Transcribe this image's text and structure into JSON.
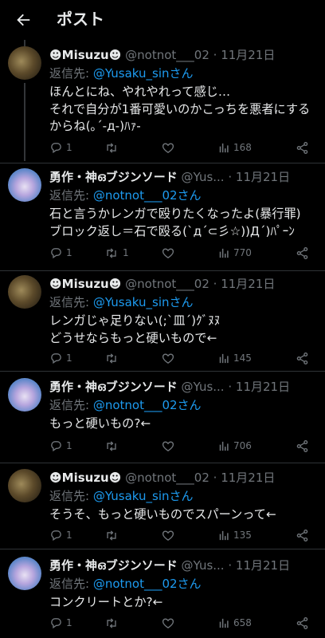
{
  "header": {
    "title": "ポスト"
  },
  "users": {
    "misuzu": {
      "name": "☻Misuzu☻",
      "handle": "@notnot___02"
    },
    "yusaku": {
      "name": "勇作・神ഒブジンソード",
      "handle": "@Yus..."
    }
  },
  "reply_prefix": "返信先:",
  "dot": "·",
  "tweets": [
    {
      "name": "☻Misuzu☻",
      "handle": "@notnot___02",
      "date": "11月21日",
      "reply_to": "@Yusaku_sinさん",
      "text": "ほんとにね、やれやれって感じ…\nそれで自分が1番可愛いのかこっちを悪者にするからね(｡´-д-)ﾊｧ-",
      "replies": "1",
      "retweets": "",
      "likes": "",
      "views": "168"
    },
    {
      "name": "勇作・神ഒブジンソード",
      "handle": "@Yus...",
      "date": "11月21日",
      "reply_to": "@notnot___02さん",
      "text": "石と言うかレンガで殴りたくなったよ(暴行罪)\nブロック返し＝石で殴る(`д´⊂彡☆))Д´)ﾊﾟｰﾝ",
      "replies": "1",
      "retweets": "1",
      "likes": "",
      "views": "770"
    },
    {
      "name": "☻Misuzu☻",
      "handle": "@notnot___02",
      "date": "11月21日",
      "reply_to": "@Yusaku_sinさん",
      "text": "レンガじゃ足りない(;`皿´)ｸﾞﾇﾇ\nどうせならもっと硬いもので←",
      "replies": "1",
      "retweets": "",
      "likes": "",
      "views": "145"
    },
    {
      "name": "勇作・神ഒブジンソード",
      "handle": "@Yus...",
      "date": "11月21日",
      "reply_to": "@notnot___02さん",
      "text": "もっと硬いもの?←",
      "replies": "1",
      "retweets": "",
      "likes": "",
      "views": "706"
    },
    {
      "name": "☻Misuzu☻",
      "handle": "@notnot___02",
      "date": "11月21日",
      "reply_to": "@Yusaku_sinさん",
      "text": "そうそ、もっと硬いものでスパーンって←",
      "replies": "1",
      "retweets": "",
      "likes": "",
      "views": "135"
    },
    {
      "name": "勇作・神ഒブジンソード",
      "handle": "@Yus...",
      "date": "11月21日",
      "reply_to": "@notnot___02さん",
      "text": "コンクリートとか?←",
      "replies": "1",
      "retweets": "",
      "likes": "",
      "views": "658"
    }
  ],
  "colors": {
    "background": "#000000",
    "text": "#e7e9ea",
    "muted": "#71767b",
    "link": "#1d9bf0"
  }
}
